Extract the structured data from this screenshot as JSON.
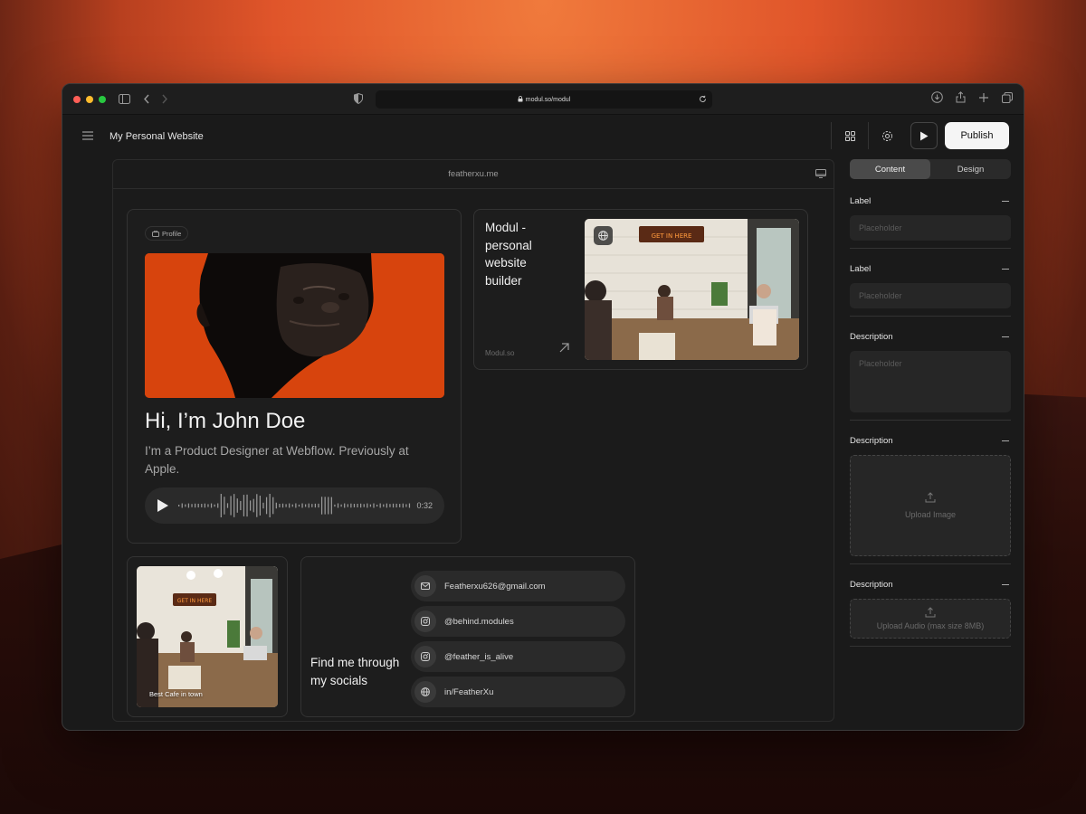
{
  "browser": {
    "url": "modul.so/modul"
  },
  "app": {
    "title": "My Personal Website",
    "publish_label": "Publish"
  },
  "canvas": {
    "domain": "featherxu.me"
  },
  "profile_card": {
    "chip": "Profile",
    "heading": "Hi, I’m John Doe",
    "bio": "I’m a Product Designer at Webflow. Previously at Apple.",
    "audio_time": "0:32"
  },
  "modul_card": {
    "title": "Modul - personal website builder",
    "domain": "Modul.so"
  },
  "cafe_card": {
    "caption": "Best Cafe in town"
  },
  "social_card": {
    "title": "Find me through my socials",
    "items": [
      {
        "icon": "mail-icon",
        "text": "Featherxu626@gmail.com"
      },
      {
        "icon": "instagram-icon",
        "text": "@behind.modules"
      },
      {
        "icon": "instagram-icon",
        "text": "@feather_is_alive"
      },
      {
        "icon": "globe-icon",
        "text": "in/FeatherXu"
      }
    ]
  },
  "panel": {
    "tabs": [
      "Content",
      "Design"
    ],
    "active_tab": "Content",
    "fields": [
      {
        "label": "Label",
        "placeholder": "Placeholder"
      },
      {
        "label": "Label",
        "placeholder": "Placeholder"
      },
      {
        "label": "Description",
        "placeholder": "Placeholder"
      },
      {
        "label": "Description",
        "upload": "Upload Image"
      },
      {
        "label": "Description",
        "upload": "Upload Audio (max size 8MB)"
      }
    ]
  },
  "colors": {
    "accent_orange": "#d7440d",
    "publish_bg": "#f5f5f5",
    "traffic_red": "#ff5f57",
    "traffic_yellow": "#febc2e",
    "traffic_green": "#28c840"
  }
}
